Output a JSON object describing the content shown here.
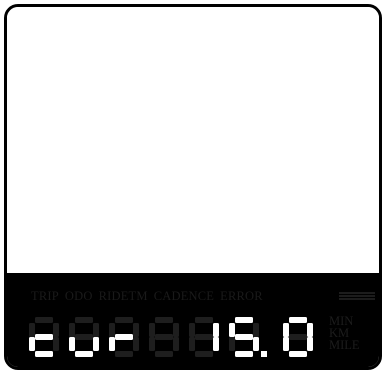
{
  "labels": [
    "TRIP",
    "ODO",
    "RIDETM",
    "CADENCE",
    "ERROR"
  ],
  "units": [
    "MIN",
    "KM",
    "MILE"
  ],
  "display": {
    "dim_digits": 6,
    "lit_text": "cur15.0",
    "mode_chars": [
      "c",
      "u",
      "r"
    ],
    "value_chars": [
      "1",
      "5",
      "0"
    ],
    "decimal_after_index": 4
  },
  "colors": {
    "lit": "#ffffff",
    "dim": "#1e1e1e",
    "background": "#000000",
    "frame": "#000000"
  }
}
